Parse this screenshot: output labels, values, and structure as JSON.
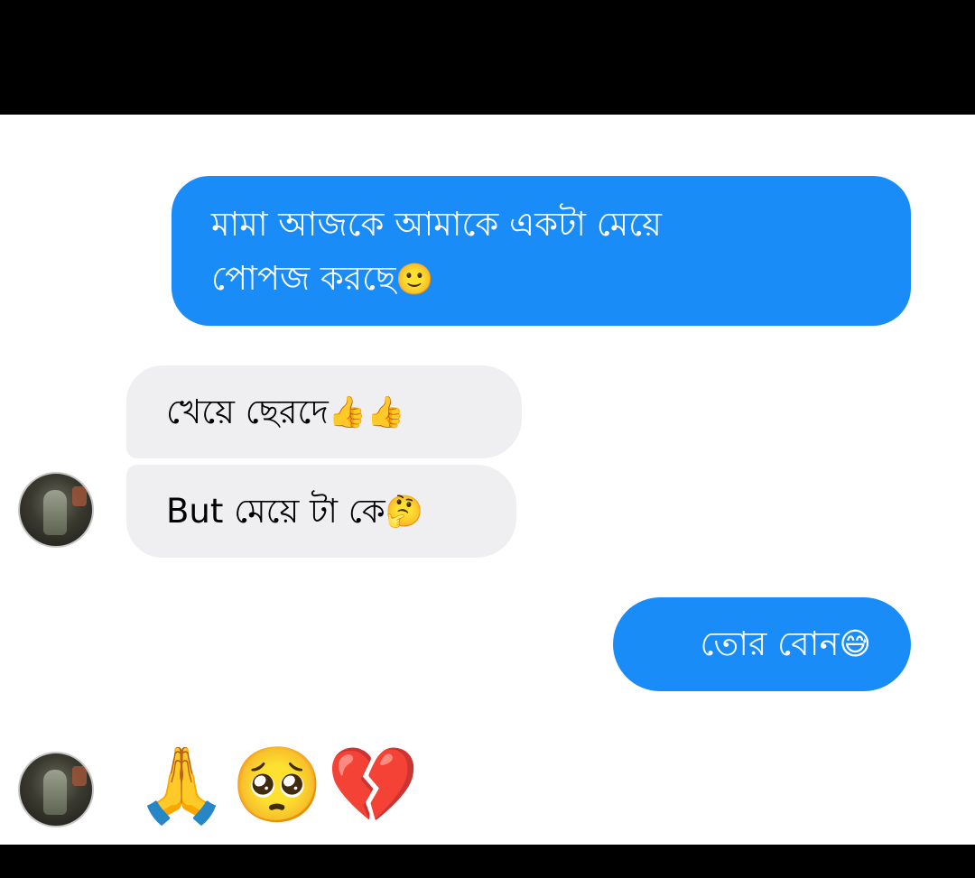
{
  "messages": [
    {
      "direction": "outgoing",
      "text_line1": "মামা আজকে আমাকে একটা মেয়ে",
      "text_line2": "পোপজ করছে",
      "emoji": "🙂"
    },
    {
      "direction": "incoming",
      "text": "খেয়ে ছেরদে ",
      "emoji": "👍👍"
    },
    {
      "direction": "incoming",
      "text": "But মেয়ে টা কে",
      "emoji": "🤔"
    },
    {
      "direction": "outgoing",
      "text": "তোর বোন",
      "emoji": "😅"
    },
    {
      "direction": "incoming",
      "emoji": "🙏🥺💔"
    }
  ],
  "colors": {
    "outgoing_bubble": "#1a8cf7",
    "incoming_bubble": "#efeff1",
    "chat_background": "#ffffff",
    "letterbox": "#000000"
  },
  "icons": {
    "avatar": "contact-avatar-photo"
  }
}
